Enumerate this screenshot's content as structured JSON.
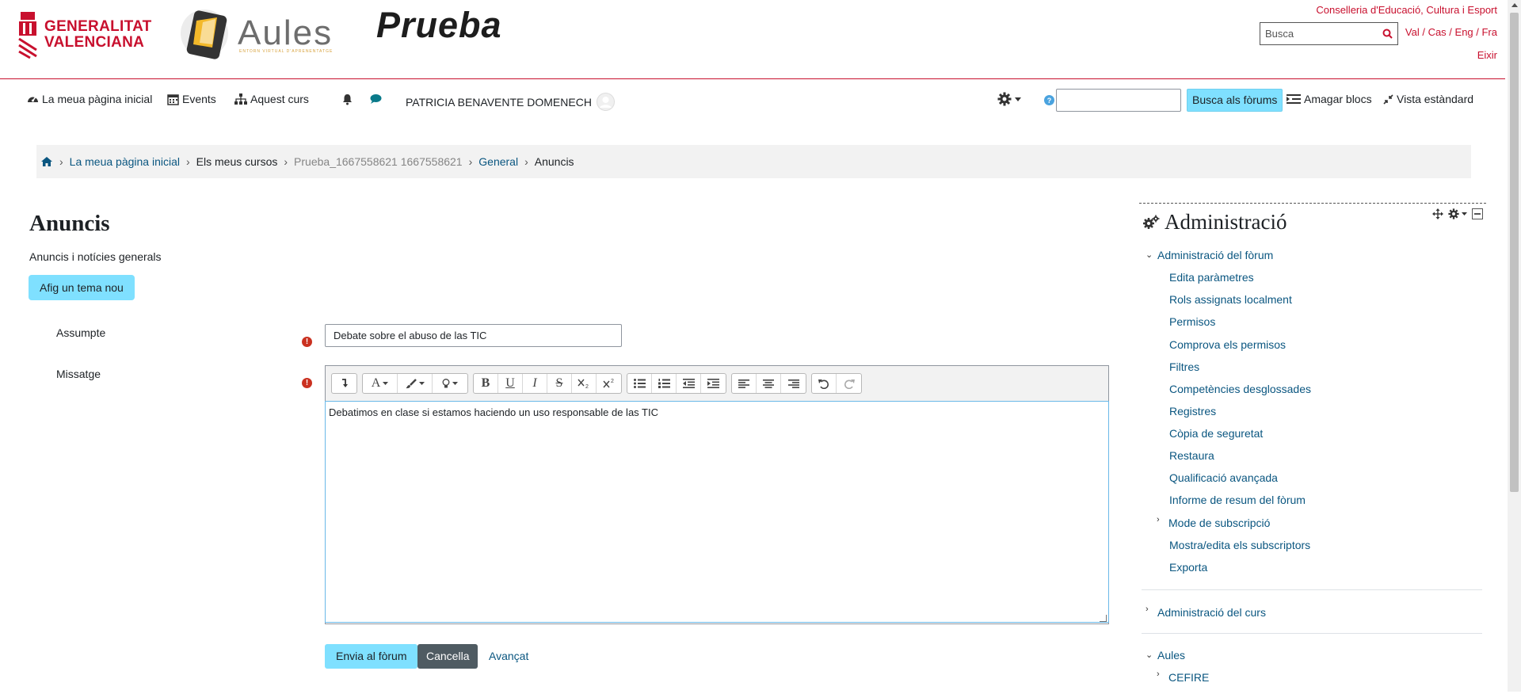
{
  "header": {
    "gva_line1": "GENERALITAT",
    "gva_line2": "VALENCIANA",
    "aules_word": "Aules",
    "aules_sub": "ENTORN VIRTUAL D'APRENENTATGE",
    "site_title": "Prueba",
    "conselleria": "Conselleria d'Educació, Cultura i Esport",
    "search_placeholder": "Busca",
    "languages": "Val / Cas / Eng / Fra",
    "exit": "Eixir"
  },
  "nav": {
    "home": "La meua pàgina inicial",
    "events": "Events",
    "course": "Aquest curs",
    "user": "PATRICIA BENAVENTE DOMENECH",
    "search_forums_button": "Busca als fòrums",
    "hide_blocks": "Amagar blocs",
    "standard_view": "Vista estàndard"
  },
  "breadcrumb": {
    "items": [
      "La meua pàgina inicial",
      "Els meus cursos",
      "Prueba_1667558621 1667558621",
      "General",
      "Anuncis"
    ]
  },
  "page": {
    "title": "Anuncis",
    "description": "Anuncis i notícies generals",
    "add_topic": "Afig un tema nou"
  },
  "form": {
    "subject_label": "Assumpte",
    "subject_value": "Debate sobre el abuso de las TIC",
    "message_label": "Missatge",
    "message_value": "Debatimos en clase si estamos haciendo un uso responsable de las TIC",
    "submit": "Envia al fòrum",
    "cancel": "Cancella",
    "advanced": "Avançat",
    "error_mark": "!"
  },
  "toolbar": {
    "font_a": "A",
    "bold": "B",
    "underline": "U",
    "italic": "I",
    "strike": "S"
  },
  "admin_block": {
    "title": "Administració",
    "forum_admin": "Administració del fòrum",
    "items": [
      "Edita paràmetres",
      "Rols assignats localment",
      "Permisos",
      "Comprova els permisos",
      "Filtres",
      "Competències desglossades",
      "Registres",
      "Còpia de seguretat",
      "Restaura",
      "Qualificació avançada",
      "Informe de resum del fòrum",
      "Mode de subscripció",
      "Mostra/edita els subscriptors",
      "Exporta"
    ],
    "course_admin": "Administració del curs",
    "aules": "Aules",
    "cefire": "CEFIRE"
  },
  "colors": {
    "accent": "#7fe0ff",
    "brand": "#c8102e",
    "link": "#0a5680"
  }
}
